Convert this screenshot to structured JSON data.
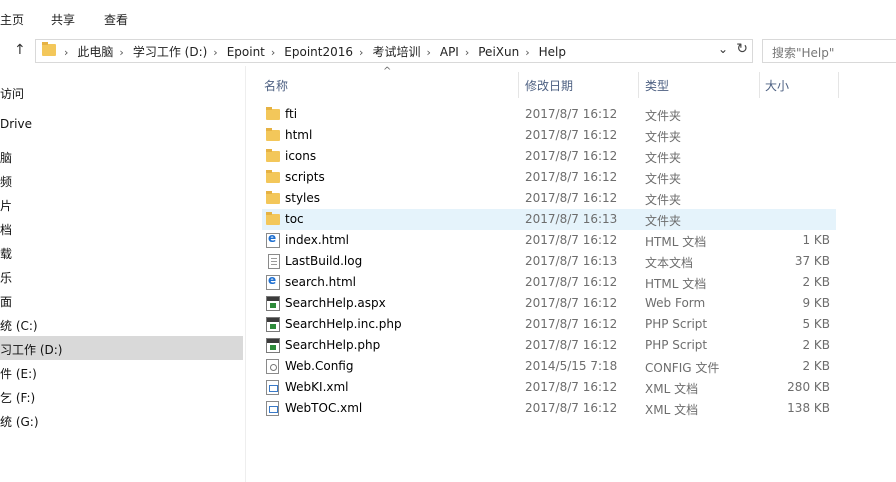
{
  "ribbon": {
    "tab_home": "主页",
    "tab_share": "共享",
    "tab_view": "查看"
  },
  "address": {
    "crumbs": [
      "此电脑",
      "学习工作 (D:)",
      "Epoint",
      "Epoint2016",
      "考试培训",
      "API",
      "PeiXun",
      "Help"
    ]
  },
  "search": {
    "placeholder": "搜索\"Help\""
  },
  "nav": {
    "items": [
      "访问",
      "Drive",
      "脑",
      "频",
      "片",
      "档",
      "载",
      "乐",
      "面",
      "统 (C:)",
      "习工作 (D:)",
      "件 (E:)",
      "乞 (F:)",
      "统 (G:)"
    ],
    "selected_index": 10
  },
  "columns": {
    "name": "名称",
    "date": "修改日期",
    "type": "类型",
    "size": "大小"
  },
  "files": [
    {
      "name": "fti",
      "date": "2017/8/7 16:12",
      "type": "文件夹",
      "size": "",
      "icon": "folder-icon"
    },
    {
      "name": "html",
      "date": "2017/8/7 16:12",
      "type": "文件夹",
      "size": "",
      "icon": "folder-icon"
    },
    {
      "name": "icons",
      "date": "2017/8/7 16:12",
      "type": "文件夹",
      "size": "",
      "icon": "folder-icon"
    },
    {
      "name": "scripts",
      "date": "2017/8/7 16:12",
      "type": "文件夹",
      "size": "",
      "icon": "folder-icon"
    },
    {
      "name": "styles",
      "date": "2017/8/7 16:12",
      "type": "文件夹",
      "size": "",
      "icon": "folder-icon"
    },
    {
      "name": "toc",
      "date": "2017/8/7 16:13",
      "type": "文件夹",
      "size": "",
      "icon": "folder-icon"
    },
    {
      "name": "index.html",
      "date": "2017/8/7 16:12",
      "type": "HTML 文档",
      "size": "1 KB",
      "icon": "html-file-icon"
    },
    {
      "name": "LastBuild.log",
      "date": "2017/8/7 16:13",
      "type": "文本文档",
      "size": "37 KB",
      "icon": "text-file-icon"
    },
    {
      "name": "search.html",
      "date": "2017/8/7 16:12",
      "type": "HTML 文档",
      "size": "2 KB",
      "icon": "html-file-icon"
    },
    {
      "name": "SearchHelp.aspx",
      "date": "2017/8/7 16:12",
      "type": "Web Form",
      "size": "9 KB",
      "icon": "script-file-icon"
    },
    {
      "name": "SearchHelp.inc.php",
      "date": "2017/8/7 16:12",
      "type": "PHP Script",
      "size": "5 KB",
      "icon": "script-file-icon"
    },
    {
      "name": "SearchHelp.php",
      "date": "2017/8/7 16:12",
      "type": "PHP Script",
      "size": "2 KB",
      "icon": "script-file-icon"
    },
    {
      "name": "Web.Config",
      "date": "2014/5/15 7:18",
      "type": "CONFIG 文件",
      "size": "2 KB",
      "icon": "config-file-icon"
    },
    {
      "name": "WebKI.xml",
      "date": "2017/8/7 16:12",
      "type": "XML 文档",
      "size": "280 KB",
      "icon": "xml-file-icon"
    },
    {
      "name": "WebTOC.xml",
      "date": "2017/8/7 16:12",
      "type": "XML 文档",
      "size": "138 KB",
      "icon": "xml-file-icon"
    }
  ],
  "selected_file_index": 5
}
